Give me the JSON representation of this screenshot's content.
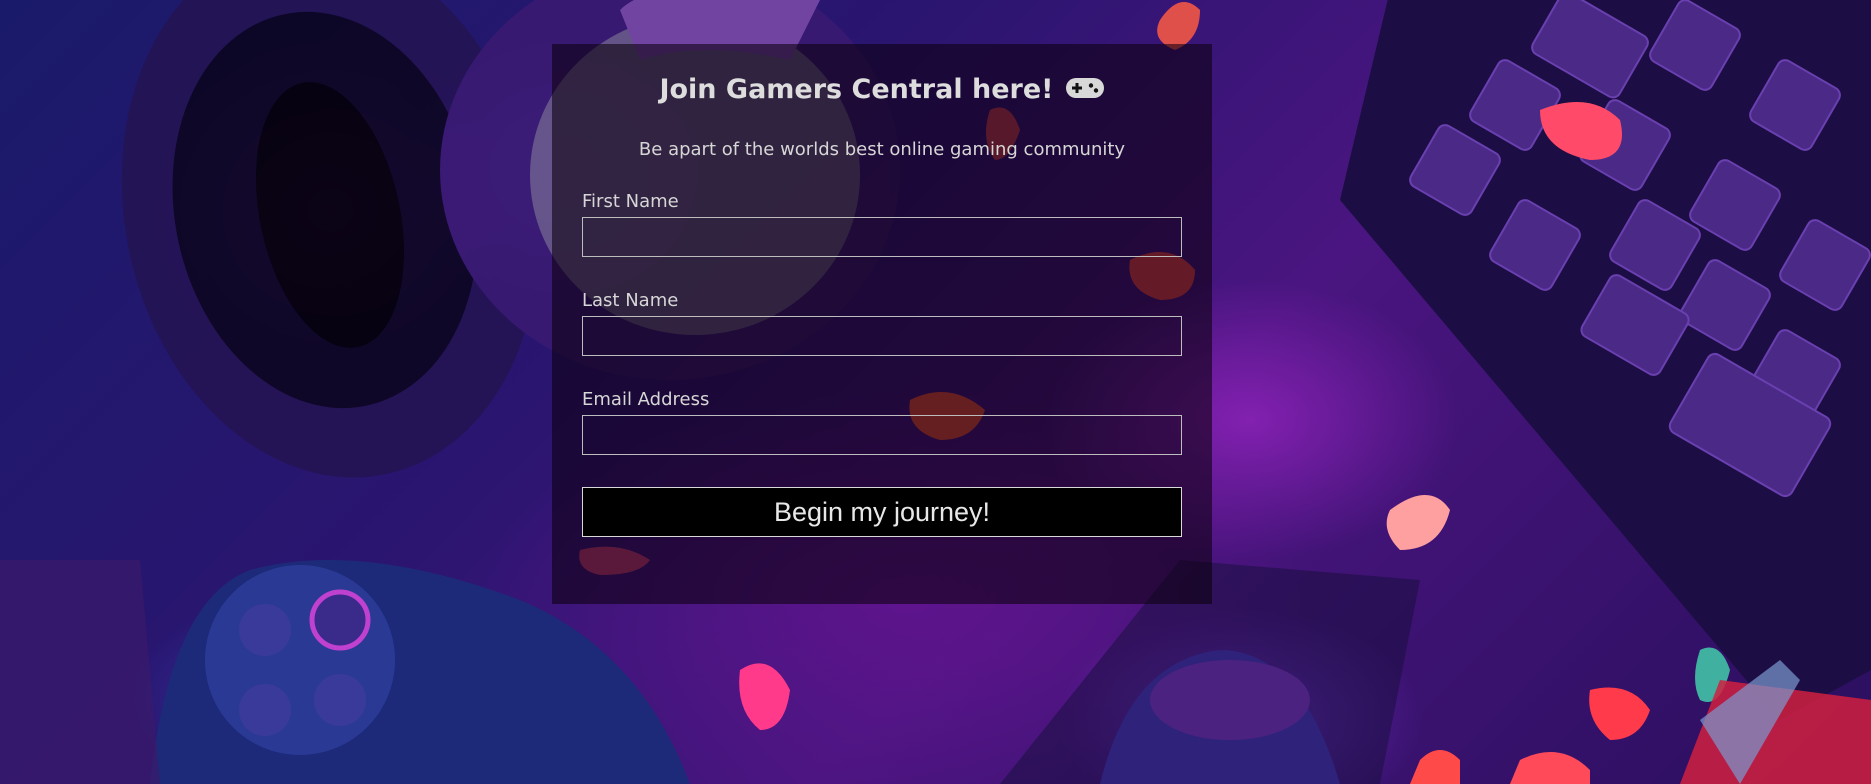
{
  "form": {
    "title": "Join Gamers Central here!",
    "title_icon": "gamepad-icon",
    "subtitle": "Be apart of the worlds best online gaming community",
    "fields": [
      {
        "label": "First Name",
        "value": "",
        "placeholder": ""
      },
      {
        "label": "Last Name",
        "value": "",
        "placeholder": ""
      },
      {
        "label": "Email Address",
        "value": "",
        "placeholder": ""
      }
    ],
    "submit_label": "Begin my journey!"
  },
  "colors": {
    "panel_bg": "#0c000e",
    "text": "#d6d6d6",
    "button_bg": "#000000",
    "accent_magenta": "#b020d0",
    "accent_blue": "#2a2a9a"
  }
}
